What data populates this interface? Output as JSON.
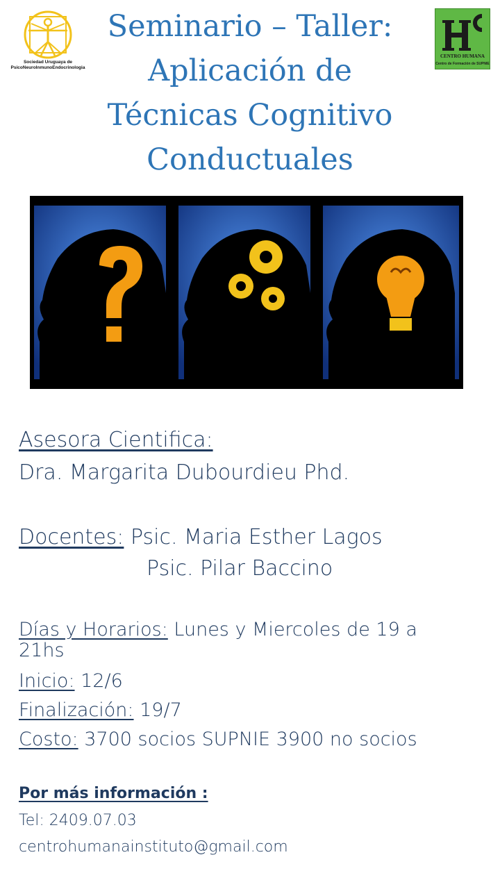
{
  "logos": {
    "left_caption_line1": "Sociedad Uruguaya de",
    "left_caption_line2": "PsicoNeuroInmunoEndocrinologia",
    "right_caption_line1": "CENTRO HUMANA",
    "right_caption_line2": "Centro de Formación de SUPNIE",
    "right_mark_letters": "HC"
  },
  "title": {
    "line1": "Seminario – Taller:",
    "line2": "Aplicación de",
    "line3": "Técnicas Cognitivo",
    "line4": "Conductuales"
  },
  "advisor": {
    "label": "Asesora Cientifica:",
    "name": "Dra. Margarita Dubourdieu Phd."
  },
  "teachers": {
    "label": "Docentes:",
    "name1": "Psic. Maria Esther Lagos",
    "name2": "Psic. Pilar Baccino"
  },
  "schedule": {
    "label": "Días y Horarios:",
    "value_line1": "Lunes y Miercoles  de 19 a",
    "value_line2": "21hs"
  },
  "start": {
    "label": "Inicio:",
    "value": "12/6"
  },
  "end": {
    "label": "Finalización:",
    "value": "19/7"
  },
  "cost": {
    "label": "Costo:",
    "value": "3700 socios SUPNIE 3900 no socios"
  },
  "contact": {
    "label": "Por más información :",
    "phone": "Tel: 2409.07.03",
    "email": "centrohumanainstituto@gmail.com"
  },
  "colors": {
    "title": "#2e75b6",
    "body": "#1f3a5f",
    "logo_right_bg": "#5fb845",
    "logo_left": "#f2c21b",
    "banner_blue": "#1f4ea8",
    "banner_orange": "#f39c12"
  }
}
